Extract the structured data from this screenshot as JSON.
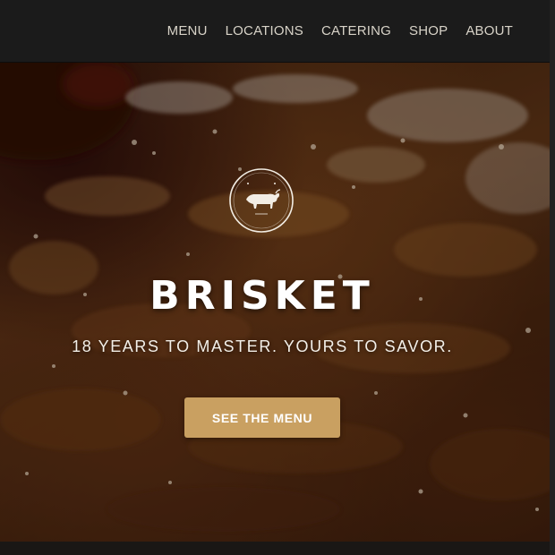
{
  "nav": {
    "items": [
      {
        "label": "MENU"
      },
      {
        "label": "LOCATIONS"
      },
      {
        "label": "CATERING"
      },
      {
        "label": "SHOP"
      },
      {
        "label": "ABOUT"
      }
    ]
  },
  "hero": {
    "logo_icon": "bull-emblem-icon",
    "title": "BRISKET",
    "tagline": "18 YEARS TO MASTER. YOURS TO SAVOR.",
    "cta_label": "SEE THE MENU"
  },
  "colors": {
    "topbar_bg": "#1b1b1b",
    "nav_text": "#d8d3c8",
    "cta_bg": "#c9a061",
    "cta_text": "#ffffff",
    "title_text": "#ffffff"
  }
}
